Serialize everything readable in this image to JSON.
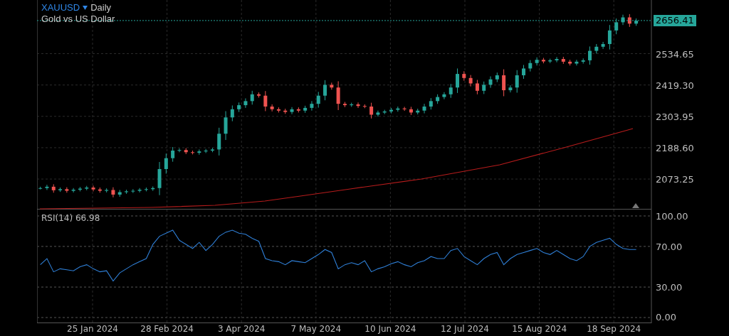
{
  "legend": {
    "symbol": "XAUUSD",
    "interval": "Daily",
    "description": "Gold vs US Dollar"
  },
  "price_chart": {
    "chart_data": {
      "type": "candlestick",
      "grid": true,
      "ylim": [
        1961,
        2732
      ],
      "yticks": [
        {
          "value": 2073.25,
          "label": "2073.25"
        },
        {
          "value": 2188.6,
          "label": "2188.60"
        },
        {
          "value": 2303.95,
          "label": "2303.95"
        },
        {
          "value": 2419.3,
          "label": "2419.30"
        },
        {
          "value": 2534.65,
          "label": "2534.65"
        }
      ],
      "ohlc": [
        [
          2040,
          2045,
          2035,
          2040
        ],
        [
          2040,
          2052,
          2033,
          2045
        ],
        [
          2045,
          2054,
          2023,
          2032
        ],
        [
          2032,
          2042,
          2026,
          2036
        ],
        [
          2036,
          2043,
          2023,
          2030
        ],
        [
          2030,
          2040,
          2024,
          2034
        ],
        [
          2034,
          2044,
          2028,
          2038
        ],
        [
          2038,
          2048,
          2032,
          2042
        ],
        [
          2042,
          2049,
          2028,
          2035
        ],
        [
          2035,
          2042,
          2023,
          2030
        ],
        [
          2030,
          2039,
          2024,
          2033
        ],
        [
          2033,
          2043,
          2006,
          2016
        ],
        [
          2016,
          2033,
          2008,
          2025
        ],
        [
          2025,
          2034,
          2019,
          2028
        ],
        [
          2028,
          2036,
          2022,
          2030
        ],
        [
          2030,
          2040,
          2024,
          2034
        ],
        [
          2034,
          2042,
          2028,
          2036
        ],
        [
          2036,
          2046,
          2030,
          2040
        ],
        [
          2040,
          2136,
          2014,
          2110
        ],
        [
          2110,
          2167,
          2093,
          2150
        ],
        [
          2150,
          2191,
          2137,
          2178
        ],
        [
          2178,
          2186,
          2172,
          2180
        ],
        [
          2180,
          2187,
          2165,
          2172
        ],
        [
          2172,
          2178,
          2164,
          2170
        ],
        [
          2170,
          2182,
          2163,
          2175
        ],
        [
          2175,
          2184,
          2169,
          2178
        ],
        [
          2178,
          2188,
          2172,
          2182
        ],
        [
          2182,
          2262,
          2160,
          2240
        ],
        [
          2240,
          2323,
          2217,
          2300
        ],
        [
          2300,
          2344,
          2286,
          2330
        ],
        [
          2330,
          2355,
          2320,
          2345
        ],
        [
          2345,
          2370,
          2335,
          2360
        ],
        [
          2360,
          2398,
          2347,
          2385
        ],
        [
          2385,
          2392,
          2373,
          2380
        ],
        [
          2380,
          2397,
          2323,
          2340
        ],
        [
          2340,
          2348,
          2322,
          2330
        ],
        [
          2330,
          2337,
          2318,
          2325
        ],
        [
          2325,
          2332,
          2313,
          2320
        ],
        [
          2320,
          2338,
          2312,
          2330
        ],
        [
          2330,
          2337,
          2318,
          2325
        ],
        [
          2325,
          2343,
          2317,
          2335
        ],
        [
          2335,
          2360,
          2325,
          2350
        ],
        [
          2350,
          2394,
          2336,
          2380
        ],
        [
          2380,
          2437,
          2363,
          2420
        ],
        [
          2420,
          2428,
          2402,
          2410
        ],
        [
          2410,
          2433,
          2327,
          2350
        ],
        [
          2350,
          2357,
          2338,
          2345
        ],
        [
          2345,
          2354,
          2339,
          2348
        ],
        [
          2348,
          2355,
          2335,
          2342
        ],
        [
          2342,
          2348,
          2334,
          2340
        ],
        [
          2340,
          2354,
          2296,
          2310
        ],
        [
          2310,
          2325,
          2303,
          2318
        ],
        [
          2318,
          2328,
          2312,
          2322
        ],
        [
          2322,
          2335,
          2315,
          2328
        ],
        [
          2328,
          2340,
          2321,
          2333
        ],
        [
          2333,
          2339,
          2324,
          2330
        ],
        [
          2330,
          2339,
          2309,
          2318
        ],
        [
          2318,
          2332,
          2311,
          2325
        ],
        [
          2325,
          2350,
          2315,
          2340
        ],
        [
          2340,
          2371,
          2329,
          2360
        ],
        [
          2360,
          2385,
          2350,
          2375
        ],
        [
          2375,
          2393,
          2367,
          2385
        ],
        [
          2385,
          2423,
          2372,
          2410
        ],
        [
          2410,
          2480,
          2390,
          2460
        ],
        [
          2460,
          2470,
          2435,
          2445
        ],
        [
          2445,
          2456,
          2414,
          2425
        ],
        [
          2425,
          2438,
          2385,
          2398
        ],
        [
          2398,
          2432,
          2386,
          2420
        ],
        [
          2420,
          2451,
          2409,
          2440
        ],
        [
          2440,
          2465,
          2430,
          2455
        ],
        [
          2455,
          2477,
          2378,
          2400
        ],
        [
          2400,
          2418,
          2392,
          2410
        ],
        [
          2410,
          2474,
          2391,
          2455
        ],
        [
          2455,
          2493,
          2442,
          2480
        ],
        [
          2480,
          2511,
          2469,
          2500
        ],
        [
          2500,
          2521,
          2491,
          2512
        ],
        [
          2512,
          2519,
          2499,
          2506
        ],
        [
          2506,
          2516,
          2500,
          2510
        ],
        [
          2510,
          2522,
          2503,
          2515
        ],
        [
          2515,
          2523,
          2497,
          2505
        ],
        [
          2505,
          2512,
          2491,
          2498
        ],
        [
          2498,
          2512,
          2491,
          2505
        ],
        [
          2505,
          2517,
          2498,
          2510
        ],
        [
          2510,
          2561,
          2494,
          2545
        ],
        [
          2545,
          2570,
          2535,
          2560
        ],
        [
          2560,
          2578,
          2552,
          2570
        ],
        [
          2570,
          2640,
          2550,
          2620
        ],
        [
          2620,
          2664,
          2606,
          2650
        ],
        [
          2650,
          2678,
          2640,
          2668
        ],
        [
          2668,
          2680,
          2633,
          2645
        ],
        [
          2645,
          2664,
          2637,
          2656
        ]
      ]
    }
  },
  "last_price": {
    "label": "2656.41",
    "color": "#26a69a"
  },
  "rsi_chart": {
    "label": "RSI(14) 66.98",
    "chart_data": {
      "type": "line",
      "grid": true,
      "ylim": [
        -5.6,
        106.3
      ],
      "yticks": [
        {
          "value": 0,
          "label": "0.00"
        },
        {
          "value": 30,
          "label": "30.00"
        },
        {
          "value": 70,
          "label": "70.00"
        },
        {
          "value": 100,
          "label": "100.00"
        }
      ],
      "series": [
        {
          "color": "#2f7fd6",
          "values": [
            52,
            58,
            45,
            48,
            47,
            46,
            50,
            52,
            48,
            45,
            46,
            36,
            44,
            48,
            52,
            55,
            58,
            72,
            80,
            83,
            86,
            76,
            72,
            68,
            74,
            66,
            72,
            80,
            84,
            86,
            83,
            82,
            78,
            75,
            58,
            56,
            55,
            52,
            56,
            55,
            54,
            58,
            62,
            67,
            64,
            48,
            52,
            54,
            52,
            56,
            45,
            48,
            50,
            53,
            55,
            52,
            50,
            54,
            56,
            60,
            58,
            58,
            66,
            68,
            60,
            56,
            52,
            58,
            62,
            64,
            52,
            58,
            62,
            64,
            66,
            68,
            64,
            62,
            66,
            62,
            58,
            56,
            60,
            70,
            74,
            76,
            78,
            72,
            68,
            67,
            67
          ]
        }
      ]
    }
  },
  "time_axis": [
    "25 Jan 2024",
    "28 Feb 2024",
    "3 Apr 2024",
    "7 May 2024",
    "10 Jun 2024",
    "12 Jul 2024",
    "15 Aug 2024",
    "18 Sep 2024"
  ]
}
